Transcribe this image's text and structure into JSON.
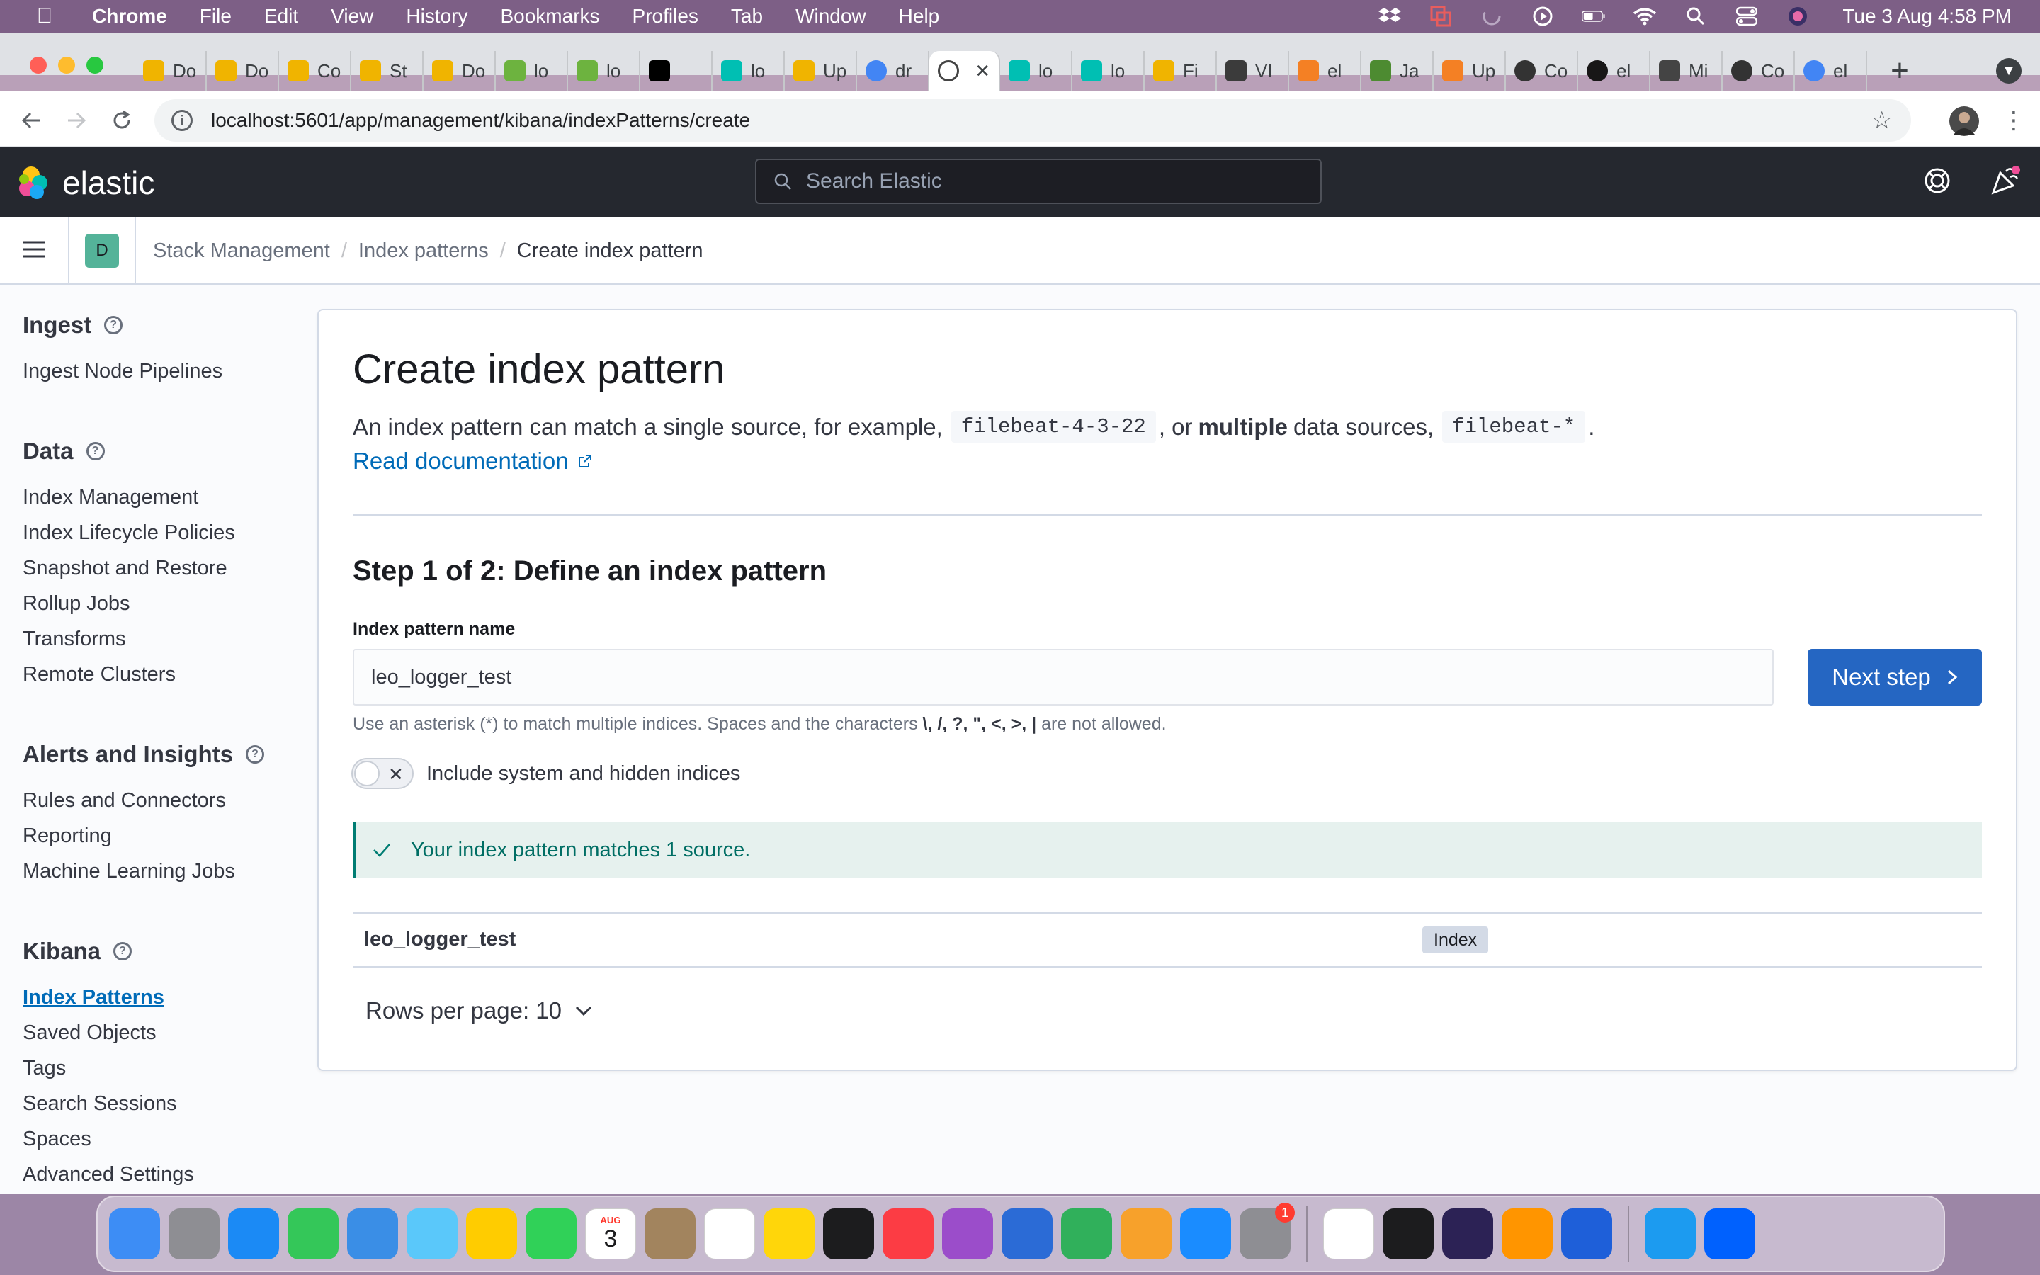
{
  "menubar": {
    "app_name": "Chrome",
    "items": [
      "File",
      "Edit",
      "View",
      "History",
      "Bookmarks",
      "Profiles",
      "Tab",
      "Window",
      "Help"
    ],
    "clock": "Tue 3 Aug  4:58 PM"
  },
  "browser": {
    "tabs": [
      {
        "label": "Do",
        "icon": "kibana-favicon"
      },
      {
        "label": "Do",
        "icon": "kibana-favicon"
      },
      {
        "label": "Co",
        "icon": "kibana-favicon"
      },
      {
        "label": "St",
        "icon": "kibana-favicon"
      },
      {
        "label": "Do",
        "icon": "kibana-favicon"
      },
      {
        "label": "lo",
        "icon": "spring-favicon"
      },
      {
        "label": "lo",
        "icon": "spring-favicon"
      },
      {
        "label": "",
        "icon": "x-favicon"
      },
      {
        "label": "lo",
        "icon": "elastic-favicon"
      },
      {
        "label": "Up",
        "icon": "kibana-favicon"
      },
      {
        "label": "dr",
        "icon": "google-favicon"
      },
      {
        "label": "",
        "icon": "openai-favicon",
        "active": true
      },
      {
        "label": "lo",
        "icon": "elastic-favicon"
      },
      {
        "label": "lo",
        "icon": "elastic-favicon"
      },
      {
        "label": "Fi",
        "icon": "kibana-favicon"
      },
      {
        "label": "VI",
        "icon": "vm-favicon"
      },
      {
        "label": "el",
        "icon": "stackoverflow-favicon"
      },
      {
        "label": "Ja",
        "icon": "leaf-favicon"
      },
      {
        "label": "Up",
        "icon": "stackoverflow-favicon"
      },
      {
        "label": "Co",
        "icon": "spiral-favicon"
      },
      {
        "label": "el",
        "icon": "github-favicon"
      },
      {
        "label": "Mi",
        "icon": "doc-favicon"
      },
      {
        "label": "Co",
        "icon": "spiral-favicon"
      },
      {
        "label": "el",
        "icon": "google-favicon"
      }
    ],
    "url": "localhost:5601/app/management/kibana/indexPatterns/create"
  },
  "kibana": {
    "brand": "elastic",
    "search_placeholder": "Search Elastic",
    "space_initial": "D",
    "breadcrumbs": [
      "Stack Management",
      "Index patterns",
      "Create index pattern"
    ]
  },
  "sidenav": {
    "groups": [
      {
        "title": "Ingest",
        "items": [
          "Ingest Node Pipelines"
        ]
      },
      {
        "title": "Data",
        "items": [
          "Index Management",
          "Index Lifecycle Policies",
          "Snapshot and Restore",
          "Rollup Jobs",
          "Transforms",
          "Remote Clusters"
        ]
      },
      {
        "title": "Alerts and Insights",
        "items": [
          "Rules and Connectors",
          "Reporting",
          "Machine Learning Jobs"
        ]
      },
      {
        "title": "Kibana",
        "items": [
          "Index Patterns",
          "Saved Objects",
          "Tags",
          "Search Sessions",
          "Spaces",
          "Advanced Settings"
        ]
      }
    ],
    "selected": "Index Patterns"
  },
  "page": {
    "title": "Create index pattern",
    "desc_part1": "An index pattern can match a single source, for example,",
    "desc_code1": "filebeat-4-3-22",
    "desc_part2": ", or",
    "desc_bold": "multiple",
    "desc_part3": "data sources,",
    "desc_code2": "filebeat-*",
    "desc_part4": ".",
    "read_doc": "Read documentation",
    "step_title": "Step 1 of 2: Define an index pattern",
    "field_label": "Index pattern name",
    "input_value": "leo_logger_test",
    "next_button": "Next step",
    "help_prefix": "Use an asterisk (*) to match multiple indices. Spaces and the characters",
    "help_chars": "\\, /, ?, \", <, >, |",
    "help_suffix": "are not allowed.",
    "toggle_label": "Include system and hidden indices",
    "toggle_on": false,
    "callout": "Your index pattern matches 1 source.",
    "results": [
      {
        "name": "leo_logger_test",
        "type": "Index"
      }
    ],
    "rows_per_page": "Rows per page: 10"
  },
  "dock": {
    "apps": [
      "Finder",
      "Launchpad",
      "Safari",
      "Messages",
      "Mail",
      "Maps",
      "Photos",
      "FaceTime",
      "Calendar",
      "Contacts",
      "Reminders",
      "Notes",
      "TV",
      "Music",
      "Podcasts",
      "Keynote",
      "Numbers",
      "Pages",
      "App Store",
      "System Preferences",
      "Chrome",
      "Terminal",
      "Eclipse",
      "Sublime Text",
      "VMware",
      "Tweetbot",
      "Dropbox"
    ],
    "calendar_month": "AUG",
    "calendar_day": "3",
    "prefs_badge": "1"
  }
}
